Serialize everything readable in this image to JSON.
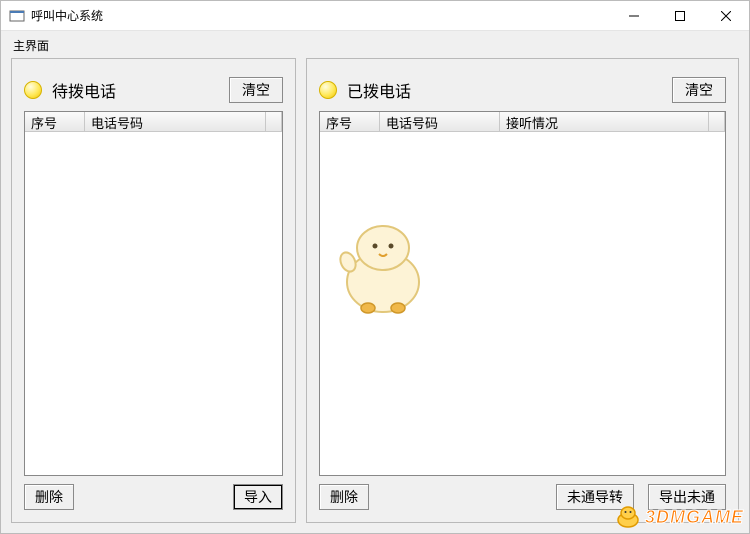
{
  "window": {
    "title": "呼叫中心系统"
  },
  "main_label": "主界面",
  "left_panel": {
    "title": "待拨电话",
    "clear_btn": "清空",
    "columns": {
      "seq": "序号",
      "phone": "电话号码"
    },
    "delete_btn": "删除",
    "import_btn": "导入"
  },
  "right_panel": {
    "title": "已拨电话",
    "clear_btn": "清空",
    "columns": {
      "seq": "序号",
      "phone": "电话号码",
      "status": "接听情况"
    },
    "delete_btn": "删除",
    "untransfer_btn": "未通导转",
    "export_btn": "导出未通"
  },
  "watermark": "3DMGAME"
}
